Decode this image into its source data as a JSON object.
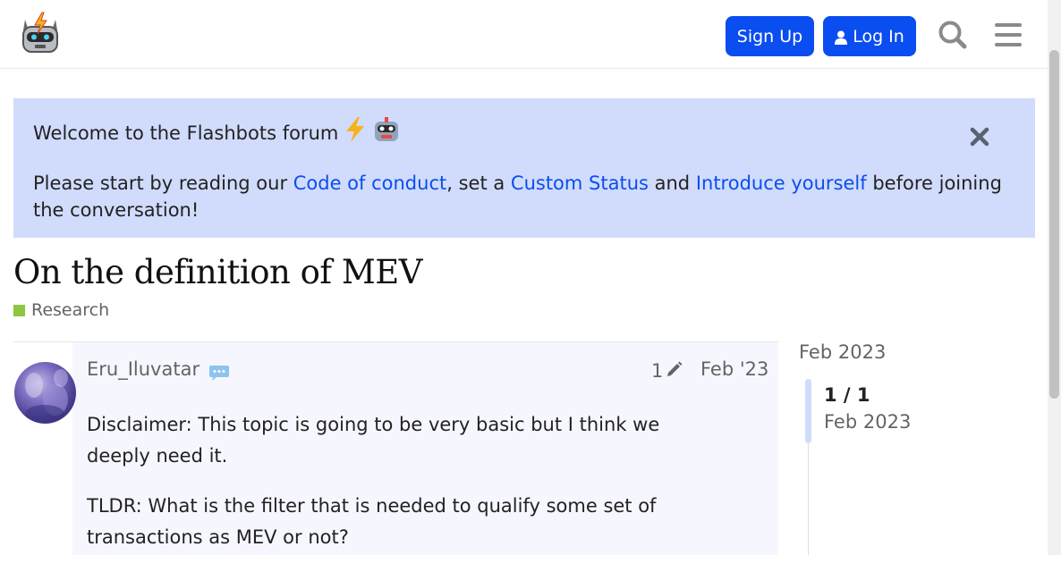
{
  "header": {
    "signup_label": "Sign Up",
    "login_label": "Log In",
    "logo_icon": "flashbots-robot-logo",
    "search_icon": "search-icon",
    "menu_icon": "hamburger-menu-icon",
    "accent_color": "#0a4df0"
  },
  "banner": {
    "title": "Welcome to the Flashbots forum",
    "body_prefix": "Please start by reading our ",
    "link1": "Code of conduct",
    "mid1": ", set a ",
    "link2": "Custom Status",
    "mid2": " and ",
    "link3": "Introduce yourself",
    "suffix": " before joining the conversation!",
    "background": "#d1dcfc"
  },
  "topic": {
    "title": "On the definition of MEV",
    "category": "Research",
    "category_color": "#8dc63f"
  },
  "post": {
    "username": "Eru_Iluvatar",
    "edit_count": "1",
    "date": "Feb '23",
    "paragraphs": [
      "Disclaimer: This topic is going to be very basic but I think we deeply need it.",
      "TLDR: What is the filter that is needed to qualify some set of transactions as MEV or not?"
    ]
  },
  "timeline": {
    "start_date": "Feb 2023",
    "position": "1 / 1",
    "current_date": "Feb 2023"
  }
}
